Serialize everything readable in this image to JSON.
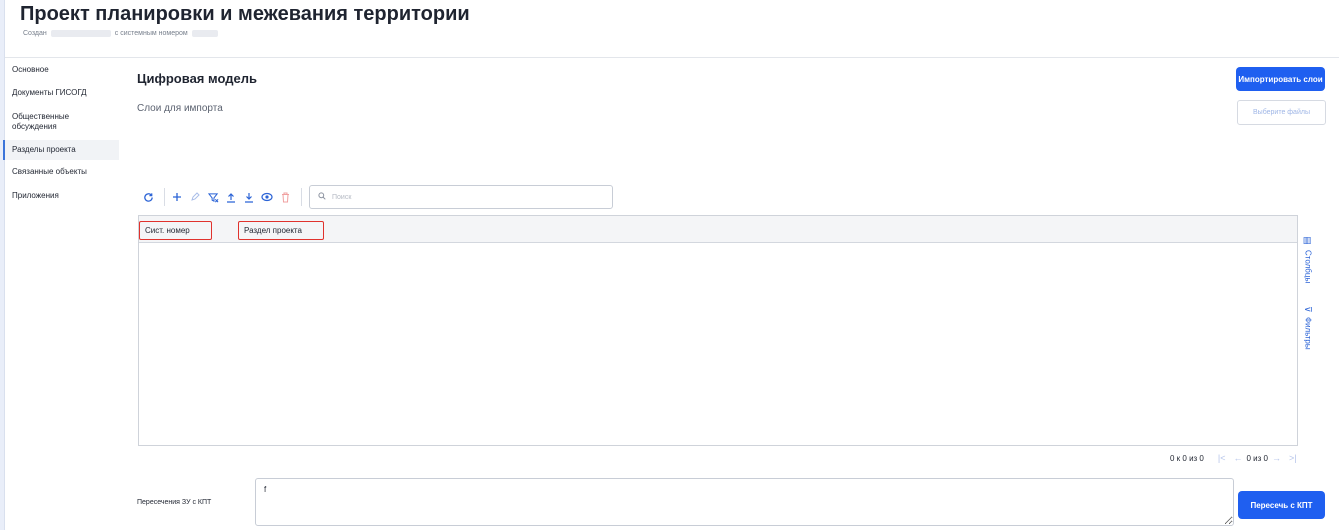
{
  "header": {
    "title": "Проект планировки и межевания территории",
    "created_label": "Создан",
    "sysnum_label": "с системным номером"
  },
  "sidebar": {
    "items": [
      {
        "label": "Основное"
      },
      {
        "label": "Документы ГИСОГД"
      },
      {
        "label": "Общественные обсуждения"
      },
      {
        "label": "Разделы проекта"
      },
      {
        "label": "Связанные объекты"
      },
      {
        "label": "Приложения"
      }
    ]
  },
  "main": {
    "title": "Цифровая модель",
    "layers_label": "Слои для импорта",
    "import_button": "Импортировать слои",
    "choose_files_button": "Выберите файлы"
  },
  "toolbar": {
    "icons": [
      "refresh-icon",
      "add-icon",
      "edit-icon",
      "clear-filter-icon",
      "upload-icon",
      "download-icon",
      "view-icon",
      "delete-icon"
    ],
    "search_placeholder": "Поиск"
  },
  "grid": {
    "columns": [
      "Сист. номер",
      "Раздел проекта"
    ],
    "rows": []
  },
  "side_panel": {
    "columns_label": "Столбцы",
    "filters_label": "Фильтры"
  },
  "pager": {
    "range_text": "0 к 0 из 0",
    "page_text": "0 из 0"
  },
  "crossing": {
    "label": "Пересечения ЗУ с КПТ",
    "value": "f",
    "button": "Пересечь с КПТ"
  },
  "colors": {
    "accent": "#1f5ff0",
    "highlight_border": "#e0322d"
  }
}
